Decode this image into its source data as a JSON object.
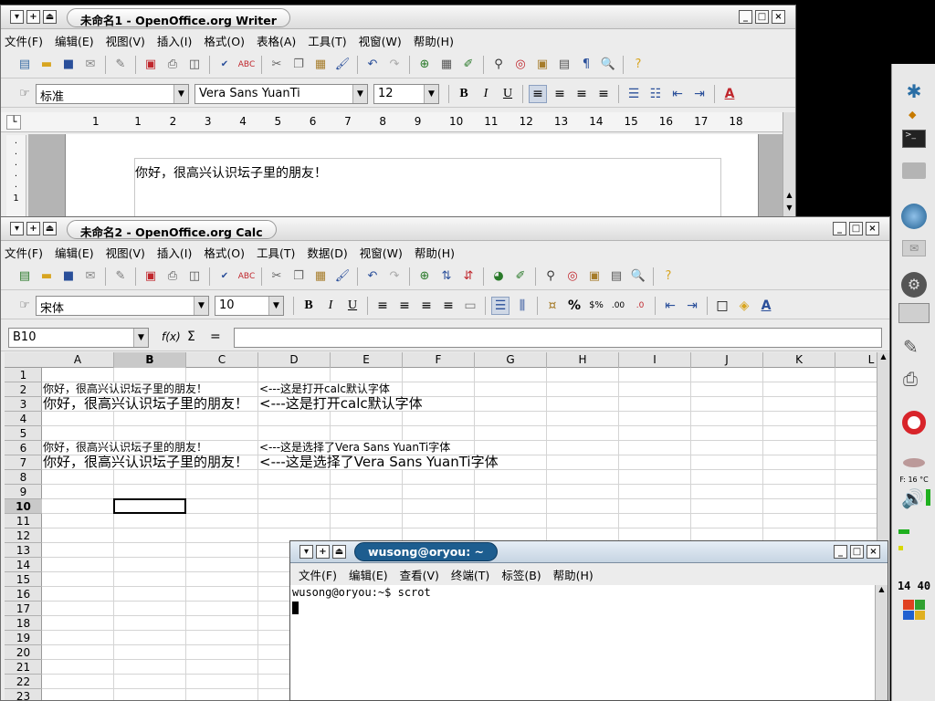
{
  "writer": {
    "title": "未命名1 - OpenOffice.org Writer",
    "menu": [
      "文件(F)",
      "编辑(E)",
      "视图(V)",
      "插入(I)",
      "格式(O)",
      "表格(A)",
      "工具(T)",
      "视窗(W)",
      "帮助(H)"
    ],
    "style": "标准",
    "font": "Vera Sans YuanTi",
    "size": "12",
    "ruler": [
      "1",
      "1",
      "2",
      "3",
      "4",
      "5",
      "6",
      "7",
      "8",
      "9",
      "10",
      "11",
      "12",
      "13",
      "14",
      "15",
      "16",
      "17",
      "18"
    ],
    "doc_text": "你好，很高兴认识坛子里的朋友！",
    "vruler_mark": "1"
  },
  "calc": {
    "title": "未命名2 - OpenOffice.org Calc",
    "menu": [
      "文件(F)",
      "编辑(E)",
      "视图(V)",
      "插入(I)",
      "格式(O)",
      "工具(T)",
      "数据(D)",
      "视窗(W)",
      "帮助(H)"
    ],
    "font": "宋体",
    "size": "10",
    "namebox": "B10",
    "fx": "f(x)",
    "sigma": "Σ",
    "equals": "=",
    "columns": [
      "A",
      "B",
      "C",
      "D",
      "E",
      "F",
      "G",
      "H",
      "I",
      "J",
      "K",
      "L"
    ],
    "rows": [
      "1",
      "2",
      "3",
      "4",
      "5",
      "6",
      "7",
      "8",
      "9",
      "10",
      "11",
      "12",
      "13",
      "14",
      "15",
      "16",
      "17",
      "18",
      "19",
      "20",
      "21",
      "22",
      "23"
    ],
    "cells": {
      "A2": "你好，很高兴认识坛子里的朋友！",
      "D2": "<---这是打开calc默认字体",
      "A3": "你好，很高兴认识坛子里的朋友！",
      "D3": "<---这是打开calc默认字体",
      "A6": "你好，很高兴认识坛子里的朋友！",
      "D6": "<---这是选择了Vera Sans YuanTi字体",
      "A7": "你好，很高兴认识坛子里的朋友！",
      "D7": "<---这是选择了Vera Sans YuanTi字体"
    }
  },
  "terminal": {
    "title": "wusong@oryou: ~",
    "menu": [
      "文件(F)",
      "编辑(E)",
      "查看(V)",
      "终端(T)",
      "标签(B)",
      "帮助(H)"
    ],
    "line": "wusong@oryou:~$ scrot"
  },
  "panel": {
    "temp": "F: 16 °C",
    "clock": "14 40"
  },
  "colors": {
    "accent": "#1d5d8f",
    "selection": "#000000"
  }
}
